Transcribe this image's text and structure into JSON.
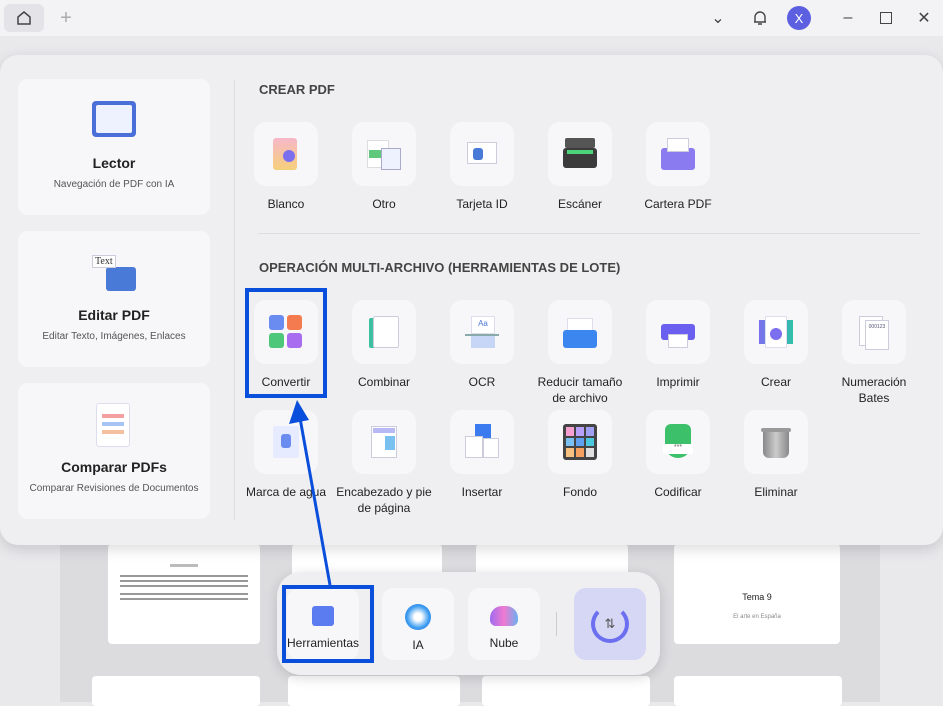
{
  "topbar": {
    "avatar_letter": "X",
    "icons": [
      "home-icon",
      "plus-icon",
      "chevron-down-icon",
      "bell-icon",
      "minimize-icon",
      "maximize-icon",
      "close-icon"
    ]
  },
  "left_cards": [
    {
      "title": "Lector",
      "subtitle": "Navegación de PDF con IA"
    },
    {
      "title": "Editar PDF",
      "subtitle": "Editar Texto, Imágenes, Enlaces",
      "icon_text": "Text"
    },
    {
      "title": "Comparar PDFs",
      "subtitle": "Comparar Revisiones de Documentos"
    }
  ],
  "create": {
    "heading": "CREAR PDF",
    "items": [
      "Blanco",
      "Otro",
      "Tarjeta ID",
      "Escáner",
      "Cartera PDF"
    ]
  },
  "batch": {
    "heading": "OPERACIÓN MULTI-ARCHIVO (HERRAMIENTAS DE LOTE)",
    "row1": [
      "Convertir",
      "Combinar",
      "OCR",
      "Reducir tamaño de archivo",
      "Imprimir",
      "Crear",
      "Numeración Bates"
    ],
    "row2": [
      "Marca de agua",
      "Encabezado y pie de página",
      "Insertar",
      "Fondo",
      "Codificar",
      "Eliminar"
    ]
  },
  "dock": {
    "items": [
      "Herramientas",
      "IA",
      "Nube"
    ]
  },
  "background_doc": {
    "title": "Tema 9",
    "subtitle": "El arte en España"
  },
  "colors": {
    "highlight": "#0a4fdc",
    "accent": "#5b5fe0"
  }
}
